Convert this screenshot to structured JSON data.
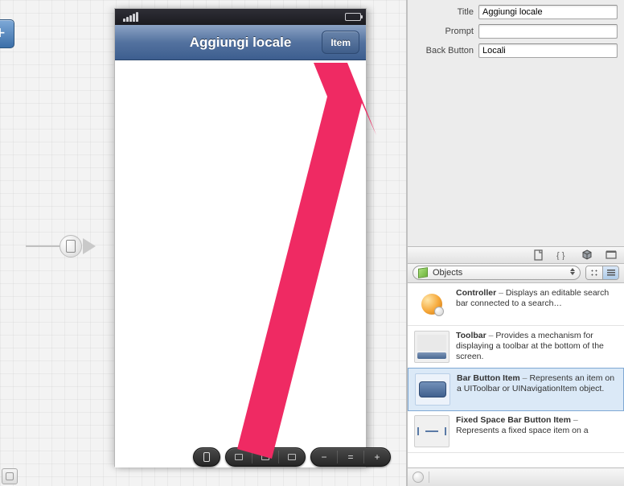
{
  "inspector": {
    "title_label": "Title",
    "title_value": "Aggiungi locale",
    "prompt_label": "Prompt",
    "prompt_value": "",
    "backbutton_label": "Back Button",
    "backbutton_value": "Locali"
  },
  "library_control": {
    "dropdown_label": "Objects"
  },
  "library": {
    "item0": {
      "title": "Controller",
      "desc": "Displays an editable search bar connected to a search…"
    },
    "item1": {
      "title": "Toolbar",
      "desc": "Provides a mechanism for displaying a toolbar at the bottom of the screen."
    },
    "item2": {
      "title": "Bar Button Item",
      "desc": "Represents an item on a UIToolbar or UINavigationItem object."
    },
    "item3": {
      "title": "Fixed Space Bar Button Item",
      "desc": "Represents a fixed space item on a"
    }
  },
  "phone": {
    "nav_title": "Aggiungi locale",
    "nav_item_label": "Item"
  }
}
